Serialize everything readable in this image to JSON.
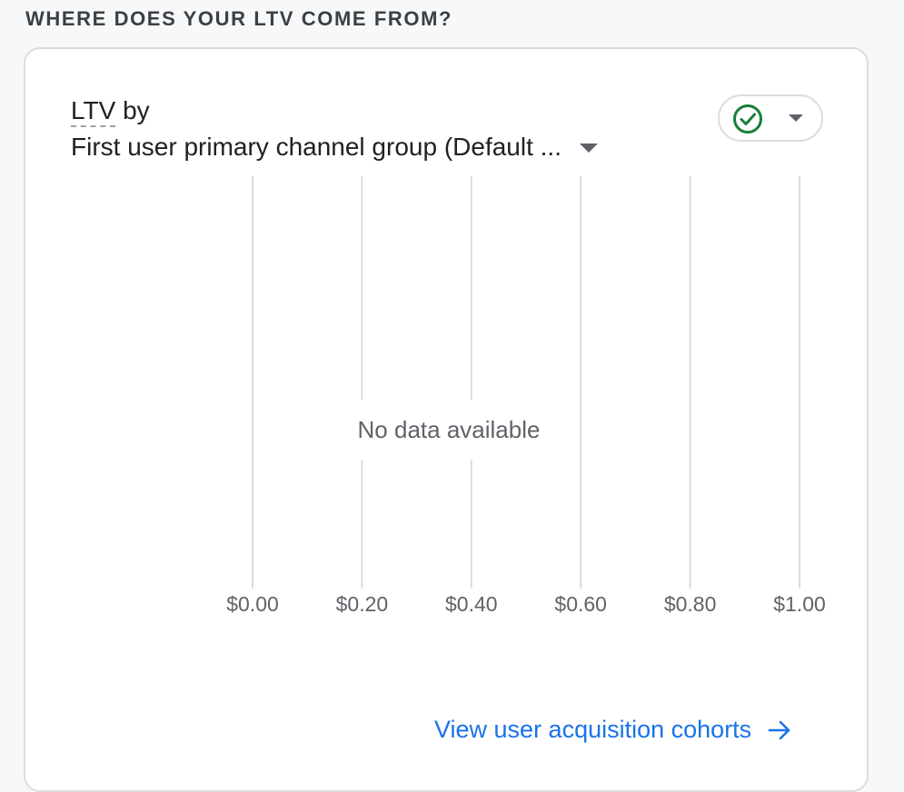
{
  "section": {
    "heading": "WHERE DOES YOUR LTV COME FROM?"
  },
  "card": {
    "metric": "LTV",
    "by_label": "by",
    "dimension_selected": "First user primary channel group (Default ...",
    "compare_icon": "check-circle-icon",
    "compare_dropdown_icon": "chevron-down-icon",
    "link_label": "View user acquisition cohorts",
    "link_icon": "arrow-right-icon"
  },
  "colors": {
    "accent_blue": "#1a73e8",
    "check_green": "#188038",
    "gridline": "#dadce0",
    "text_primary": "#202124",
    "text_secondary": "#5f6368"
  },
  "chart_data": {
    "type": "bar",
    "orientation": "horizontal",
    "categories": [],
    "values": [],
    "xlim": [
      0,
      1
    ],
    "x_ticks": [
      0,
      0.2,
      0.4,
      0.6,
      0.8,
      1.0
    ],
    "x_tick_labels": [
      "$0.00",
      "$0.20",
      "$0.40",
      "$0.60",
      "$0.80",
      "$1.00"
    ],
    "grid": true,
    "empty_message": "No data available"
  }
}
